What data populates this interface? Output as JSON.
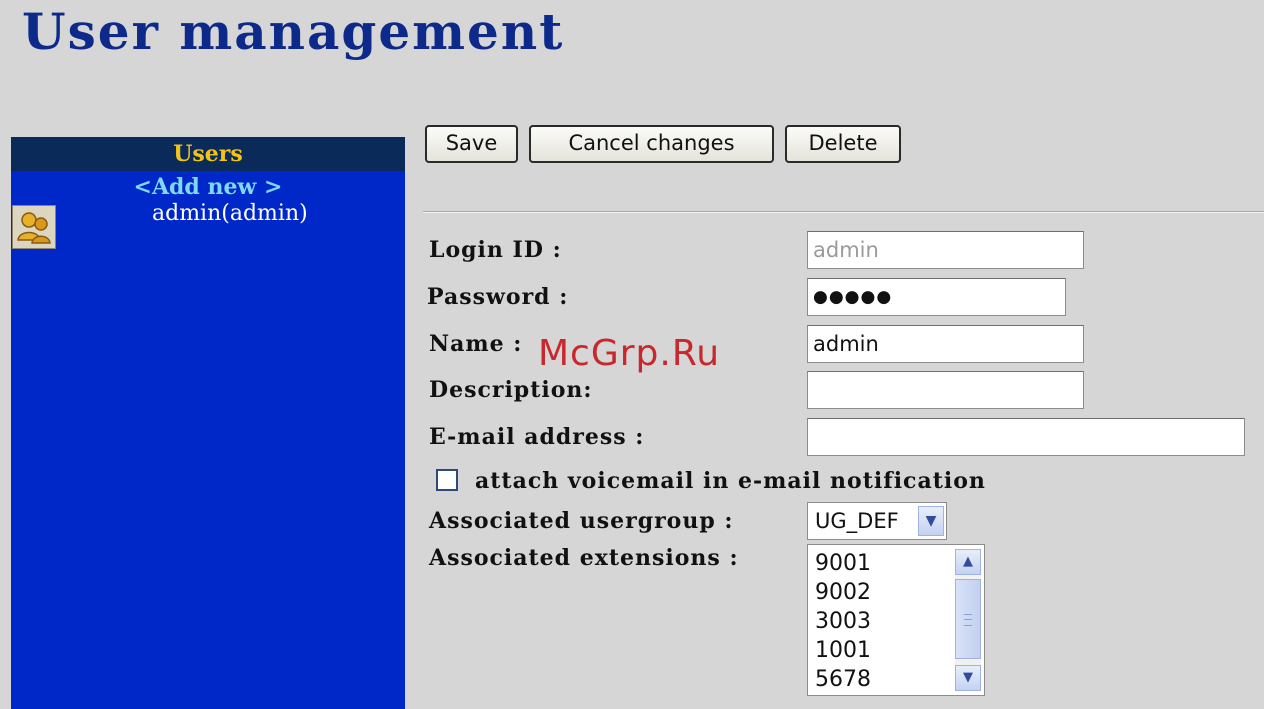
{
  "page": {
    "title": "User management"
  },
  "sidebar": {
    "header": "Users",
    "add_new": "<Add new >",
    "users": [
      {
        "label": "admin(admin)",
        "icon": "user-icon"
      }
    ]
  },
  "toolbar": {
    "save": "Save",
    "cancel": "Cancel changes",
    "delete": "Delete"
  },
  "form": {
    "login_id": {
      "label": "Login ID :",
      "value": "admin"
    },
    "password": {
      "label": "Password :",
      "value": "●●●●●"
    },
    "name": {
      "label": "Name :",
      "value": "admin"
    },
    "description": {
      "label": "Description:",
      "value": ""
    },
    "email": {
      "label": "E-mail address :",
      "value": ""
    },
    "attach_voicemail": {
      "label": "attach voicemail in e-mail notification",
      "checked": false
    },
    "usergroup": {
      "label": "Associated usergroup :",
      "value": "UG_DEF"
    },
    "extensions": {
      "label": "Associated extensions :",
      "items": [
        "9001",
        "9002",
        "3003",
        "1001",
        "5678"
      ]
    }
  },
  "watermark": "McGrp.Ru",
  "colors": {
    "title": "#0d2a8a",
    "sidebar_bg": "#0028c8",
    "sidebar_header_bg": "#0a2a5a",
    "sidebar_header_text": "#f2c318",
    "add_new_text": "#7fd8f2",
    "watermark": "#c8282c"
  }
}
